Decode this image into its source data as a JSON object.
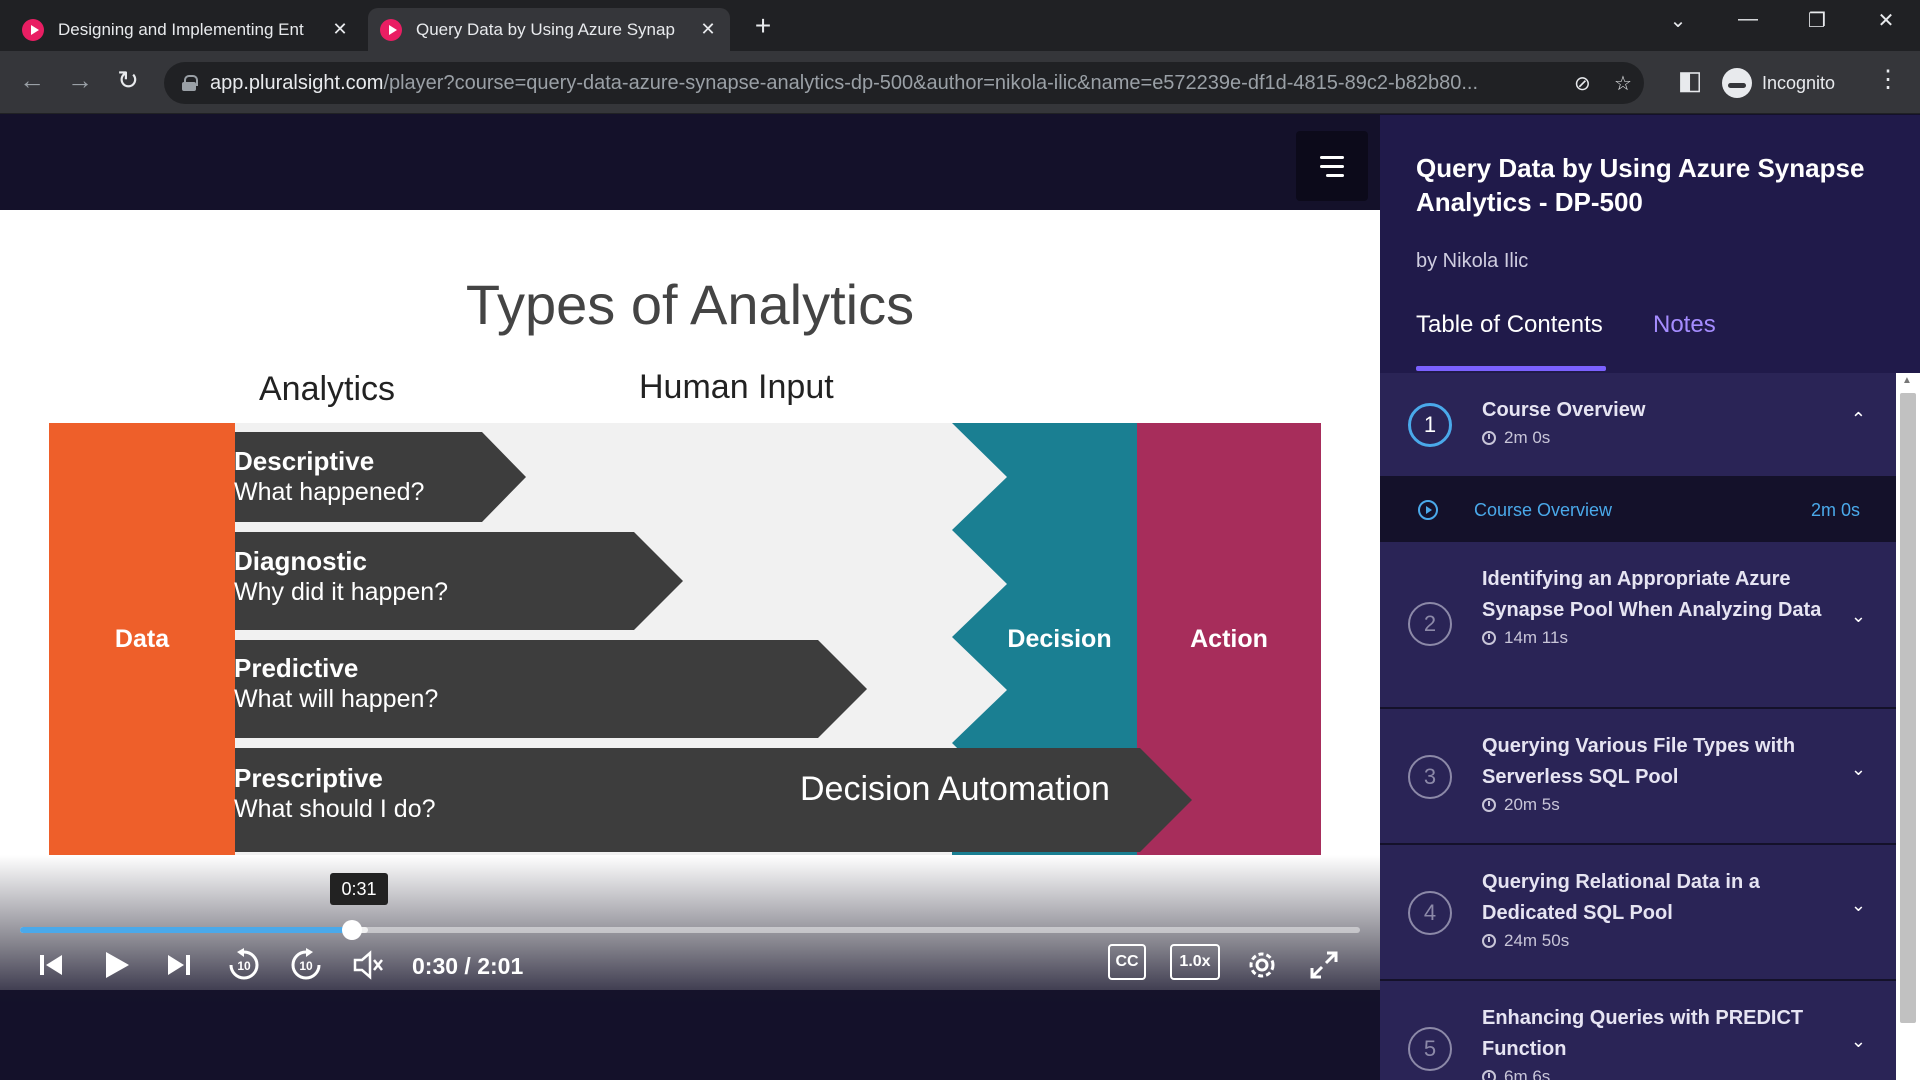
{
  "browser": {
    "tabs": [
      {
        "title": "Designing and Implementing Ent"
      },
      {
        "title": "Query Data by Using Azure Synap"
      }
    ],
    "url_host": "app.pluralsight.com",
    "url_path": "/player?course=query-data-azure-synapse-analytics-dp-500&author=nikola-ilic&name=e572239e-df1d-4815-89c2-b82b80...",
    "profile_label": "Incognito"
  },
  "slide": {
    "title": "Types of Analytics",
    "label_analytics": "Analytics",
    "label_human_input": "Human Input",
    "data_label": "Data",
    "decision_label": "Decision",
    "action_label": "Action",
    "arrows": [
      {
        "title": "Descriptive",
        "question": "What happened?"
      },
      {
        "title": "Diagnostic",
        "question": "Why did it happen?"
      },
      {
        "title": "Predictive",
        "question": "What will happen?"
      },
      {
        "title": "Prescriptive",
        "question": "What should I do?"
      }
    ],
    "automation_label": "Decision Automation"
  },
  "player": {
    "tooltip_time": "0:31",
    "time_display": "0:30 / 2:01",
    "progress_fraction": 0.248,
    "buffer_fraction": 0.26,
    "speed_label": "1.0x",
    "cc_label": "CC"
  },
  "sidebar": {
    "course_title": "Query Data by Using Azure Synapse Analytics - DP-500",
    "author": "by Nikola Ilic",
    "tab_toc": "Table of Contents",
    "tab_notes": "Notes",
    "modules": [
      {
        "num": "1",
        "title": "Course Overview",
        "duration": "2m 0s"
      },
      {
        "num": "2",
        "title": "Identifying an Appropriate Azure Synapse Pool When Analyzing Data",
        "duration": "14m 11s"
      },
      {
        "num": "3",
        "title": "Querying Various File Types with Serverless SQL Pool",
        "duration": "20m 5s"
      },
      {
        "num": "4",
        "title": "Querying Relational Data in a Dedicated SQL Pool",
        "duration": "24m 50s"
      },
      {
        "num": "5",
        "title": "Enhancing Queries with PREDICT Function",
        "duration": "6m 6s"
      }
    ],
    "clip": {
      "title": "Course Overview",
      "duration": "2m 0s"
    }
  },
  "colors": {
    "data": "#ee5f2a",
    "decision": "#1a7f92",
    "action": "#a72d5b",
    "arrow": "#3d3d3d",
    "accent": "#4aa9ea",
    "tab_accent": "#7b61ff"
  }
}
